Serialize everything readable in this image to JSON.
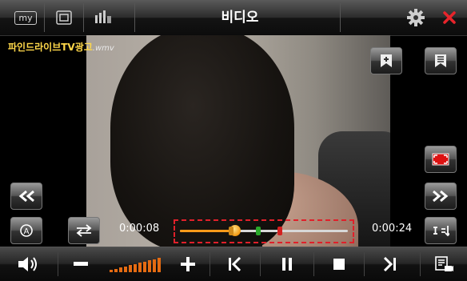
{
  "header": {
    "title": "비디오",
    "my_label": "my",
    "accent_close": "#e8242b"
  },
  "video": {
    "filename": "파인드라이브TV광고",
    "extension": ".wmv"
  },
  "player": {
    "current_time": "0:00:08",
    "total_time": "0:00:24",
    "progress": 0.33,
    "bookmarks": [
      {
        "position": 0.29,
        "color": "#d08a1a"
      },
      {
        "position": 0.45,
        "color": "#2aa82a"
      },
      {
        "position": 0.58,
        "color": "#d42020"
      }
    ]
  },
  "volume": {
    "level": 11,
    "max": 11
  },
  "icons": {
    "top_left": [
      "my-icon",
      "window-icon",
      "music-video-icon"
    ],
    "top_right": [
      "gear-icon",
      "close-icon"
    ],
    "overlay_right": [
      "bookmark-add-icon",
      "bookmark-list-icon",
      "fullscreen-icon",
      "fast-forward-icon",
      "sort-icon"
    ],
    "overlay_left": [
      "rewind-icon",
      "auto-rotate-icon",
      "repeat-icon"
    ],
    "bottom": [
      "speaker-icon",
      "minus-icon",
      "volume-level-icon",
      "plus-icon",
      "previous-icon",
      "pause-icon",
      "stop-icon",
      "next-icon",
      "playlist-icon"
    ]
  }
}
